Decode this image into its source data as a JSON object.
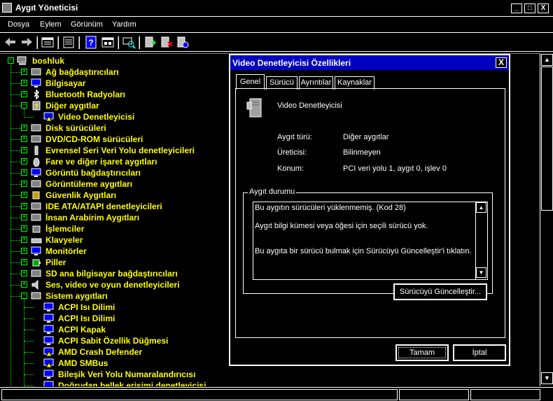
{
  "window": {
    "title": "Aygıt Yöneticisi",
    "controls": [
      "_",
      "□",
      "X"
    ]
  },
  "menu": [
    "Dosya",
    "Eylem",
    "Görünüm",
    "Yardım"
  ],
  "toolbar": {
    "icons": [
      "back-icon",
      "forward-icon",
      "up-icon",
      "properties-icon",
      "help-icon",
      "view-icon",
      "scan-hardware-icon",
      "update-driver-icon",
      "uninstall-icon",
      "disable-icon"
    ]
  },
  "tree": {
    "root": "boshluk",
    "categories": [
      {
        "label": "Ağ bağdaştırıcıları",
        "icon": "network-icon"
      },
      {
        "label": "Bilgisayar",
        "icon": "computer-icon"
      },
      {
        "label": "Bluetooth Radyoları",
        "icon": "bluetooth-icon"
      },
      {
        "label": "Diğer aygıtlar",
        "icon": "unknown-device-icon"
      },
      {
        "label": "Disk sürücüleri",
        "icon": "disk-icon"
      },
      {
        "label": "DVD/CD-ROM sürücüleri",
        "icon": "cdrom-icon"
      },
      {
        "label": "Evrensel Seri Veri Yolu denetleyicileri",
        "icon": "usb-icon"
      },
      {
        "label": "Fare ve diğer işaret aygıtları",
        "icon": "mouse-icon"
      },
      {
        "label": "Görüntü bağdaştırıcıları",
        "icon": "display-adapter-icon"
      },
      {
        "label": "Görüntüleme aygıtları",
        "icon": "camera-icon"
      },
      {
        "label": "Güvenlik Aygıtları",
        "icon": "security-icon"
      },
      {
        "label": "IDE ATA/ATAPI denetleyicileri",
        "icon": "ide-icon"
      },
      {
        "label": "İnsan Arabirim Aygıtları",
        "icon": "hid-icon"
      },
      {
        "label": "İşlemciler",
        "icon": "processor-icon"
      },
      {
        "label": "Klavyeler",
        "icon": "keyboard-icon"
      },
      {
        "label": "Monitörler",
        "icon": "monitor-icon"
      },
      {
        "label": "Piller",
        "icon": "battery-icon"
      },
      {
        "label": "SD ana bilgisayar bağdaştırıcıları",
        "icon": "sd-icon"
      },
      {
        "label": "Ses, video ve oyun denetleyicileri",
        "icon": "sound-icon"
      },
      {
        "label": "Sistem aygıtları",
        "icon": "system-icon"
      }
    ],
    "other_children": [
      "Video Denetleyicisi"
    ],
    "system_children": [
      "ACPI Isı Dilimi",
      "ACPI Isı Dilimi",
      "ACPI Kapak",
      "ACPI Sabit Özellik Düğmesi",
      "AMD Crash Defender",
      "AMD SMBus",
      "Bileşik Veri Yolu Numaralandırıcısı",
      "Doğrudan bellek erişimi denetleyicisi"
    ]
  },
  "dialog": {
    "title": "Video Denetleyicisi Özellikleri",
    "close": "X",
    "tabs": [
      "Genel",
      "Sürücü",
      "Ayrıntılar",
      "Kaynaklar"
    ],
    "active_tab": "Genel",
    "device_name": "Video Denetleyicisi",
    "fields": [
      {
        "label": "Aygıt türü:",
        "value": "Diğer aygıtlar"
      },
      {
        "label": "Üreticisi:",
        "value": "Bilinmeyen"
      },
      {
        "label": "Konum:",
        "value": "PCI veri yolu 1, aygıt 0, işlev 0"
      }
    ],
    "status_group": "Aygıt durumu",
    "status_lines": [
      "Bu aygıtın sürücüleri yüklenmemiş. (Kod 28)",
      "Aygıt bilgi kümesi veya öğesi için seçili sürücü yok.",
      "Bu aygıta bir sürücü bulmak için Sürücüyü Güncelleştir'i tıklatın."
    ],
    "update_button": "Sürücüyü Güncelleştir...",
    "ok_button": "Tamam",
    "cancel_button": "İptal"
  },
  "colors": {
    "background": "#000000",
    "foreground": "#ffffff",
    "tree_text": "#ffff00",
    "tree_lines": "#00ff00",
    "dialog_title": "#0000c0"
  }
}
